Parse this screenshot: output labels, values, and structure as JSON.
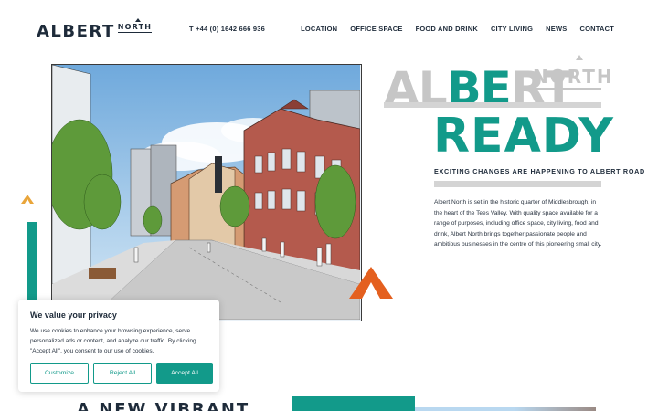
{
  "header": {
    "logo_main": "ALBERT",
    "logo_sub": "NORTH",
    "phone": "T +44 (0) 1642 666 936",
    "nav": [
      "LOCATION",
      "OFFICE SPACE",
      "FOOD AND DRINK",
      "CITY LIVING",
      "NEWS",
      "CONTACT"
    ]
  },
  "hero": {
    "title_grey_1": "AL",
    "title_teal": "BE",
    "title_grey_2": "RT",
    "title_north": "NORTH",
    "title_ready": "READY",
    "subheading": "EXCITING CHANGES ARE HAPPENING TO ALBERT ROAD",
    "body": "Albert North is set in the historic quarter of Middlesbrough, in the heart of the Tees Valley. With quality space available for a range of purposes, including office space, city living, food and drink, Albert North brings together passionate people and ambitious businesses in the centre of this pioneering small city."
  },
  "lower": {
    "heading": "A NEW VIBRANT"
  },
  "cookie_banner": {
    "title": "We value your privacy",
    "text": "We use cookies to enhance your browsing experience, serve personalized ads or content, and analyze our traffic. By clicking \"Accept All\", you consent to our use of cookies.",
    "customize": "Customize",
    "reject": "Reject All",
    "accept": "Accept All"
  },
  "colors": {
    "teal": "#129a8a",
    "orange": "#e4601f",
    "yellow": "#e9a53a",
    "navy": "#1e2b3a",
    "grey": "#c6c6c6"
  }
}
